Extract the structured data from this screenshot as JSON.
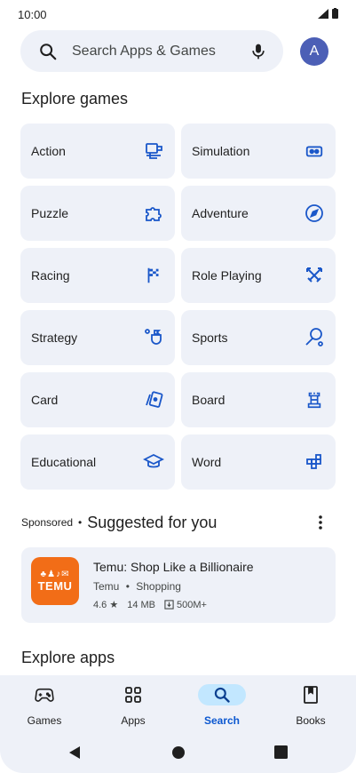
{
  "status": {
    "time": "10:00"
  },
  "search": {
    "placeholder": "Search Apps & Games"
  },
  "avatar": {
    "initial": "A",
    "color": "#4c5fb6"
  },
  "explore_games": {
    "title": "Explore games",
    "tiles": [
      {
        "label": "Action",
        "icon": "action-icon"
      },
      {
        "label": "Simulation",
        "icon": "simulation-icon"
      },
      {
        "label": "Puzzle",
        "icon": "puzzle-icon"
      },
      {
        "label": "Adventure",
        "icon": "compass-icon"
      },
      {
        "label": "Racing",
        "icon": "checkered-flag-icon"
      },
      {
        "label": "Role Playing",
        "icon": "crossed-swords-icon"
      },
      {
        "label": "Strategy",
        "icon": "strategy-icon"
      },
      {
        "label": "Sports",
        "icon": "sports-icon"
      },
      {
        "label": "Card",
        "icon": "cards-icon"
      },
      {
        "label": "Board",
        "icon": "chess-rook-icon"
      },
      {
        "label": "Educational",
        "icon": "graduation-cap-icon"
      },
      {
        "label": "Word",
        "icon": "word-blocks-icon"
      }
    ]
  },
  "suggested": {
    "sponsored_label": "Sponsored",
    "separator": "•",
    "title": "Suggested for you",
    "app": {
      "name": "Temu: Shop Like a Billionaire",
      "developer": "Temu",
      "category": "Shopping",
      "rating": "4.6 ★",
      "size": "14 MB",
      "downloads": "500M+",
      "icon_text": "TEMU",
      "icon_color": "#f26d17"
    }
  },
  "explore_apps": {
    "title": "Explore apps"
  },
  "bottom_nav": {
    "items": [
      {
        "label": "Games",
        "active": false
      },
      {
        "label": "Apps",
        "active": false
      },
      {
        "label": "Search",
        "active": true
      },
      {
        "label": "Books",
        "active": false
      }
    ]
  },
  "colors": {
    "accent": "#0b57d0",
    "tile_bg": "#eef1f8",
    "active_pill": "#c2e7ff",
    "icon_blue": "#1a57c9"
  }
}
